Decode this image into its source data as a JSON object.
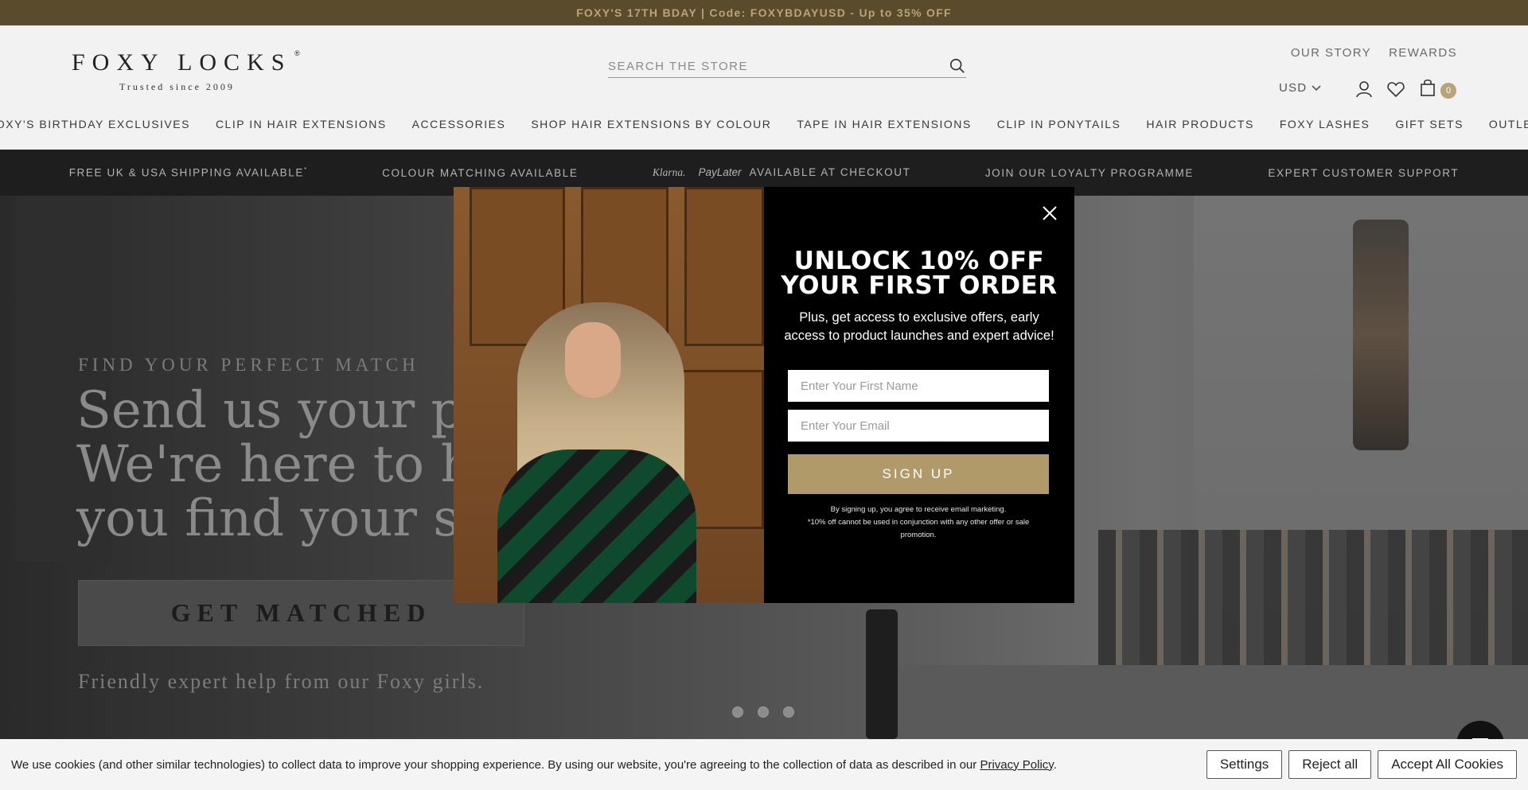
{
  "announcement": "FOXY'S 17TH BDAY | Code: FOXYBDAYUSD - Up to 35% OFF",
  "logo": {
    "name": "FOXY LOCKS",
    "tagline": "Trusted since 2009",
    "reg": "®"
  },
  "search": {
    "placeholder": "SEARCH THE STORE"
  },
  "util_links": [
    "OUR STORY",
    "REWARDS"
  ],
  "currency": "USD",
  "cart_count": "0",
  "nav": [
    "FOXY'S BIRTHDAY EXCLUSIVES",
    "CLIP IN HAIR EXTENSIONS",
    "ACCESSORIES",
    "SHOP HAIR EXTENSIONS BY COLOUR",
    "TAPE IN HAIR EXTENSIONS",
    "CLIP IN PONYTAILS",
    "HAIR PRODUCTS",
    "FOXY LASHES",
    "GIFT SETS",
    "OUTLET"
  ],
  "usp": {
    "shipping": "FREE UK & USA SHIPPING AVAILABLE",
    "shipping_mark": "*",
    "colour": "COLOUR MATCHING AVAILABLE",
    "klarna": "Klarna.",
    "paylater": "PayLater",
    "checkout": "AVAILABLE AT CHECKOUT",
    "loyalty": "JOIN OUR LOYALTY PROGRAMME",
    "support": "EXPERT CUSTOMER SUPPORT"
  },
  "hero": {
    "eyebrow": "FIND YOUR PERFECT MATCH",
    "title": "Send us your pho We're here to hel you find your sha",
    "button": "GET MATCHED",
    "tagline": "Friendly expert help from our Foxy girls."
  },
  "popup": {
    "headline_1": "UNLOCK 10% OFF",
    "headline_2": "YOUR FIRST ORDER",
    "sub": "Plus, get access to exclusive offers, early access to product launches and expert advice!",
    "first_name_placeholder": "Enter Your First Name",
    "email_placeholder": "Enter Your Email",
    "button": "SIGN UP",
    "fine_1": "By signing up, you agree to receive email marketing.",
    "fine_2": "*10% off cannot be used in conjunction with any other offer or sale promotion."
  },
  "cookie": {
    "text": "We use cookies (and other similar technologies) to collect data to improve your shopping experience. By using our website, you're agreeing to the collection of data as described in our ",
    "link": "Privacy Policy",
    "end": ".",
    "settings": "Settings",
    "reject": "Reject all",
    "accept": "Accept All Cookies"
  },
  "colors": {
    "accent": "#b09a6a",
    "announce_bg": "#5a4b2c",
    "usp_bg": "#1e1e1e"
  }
}
